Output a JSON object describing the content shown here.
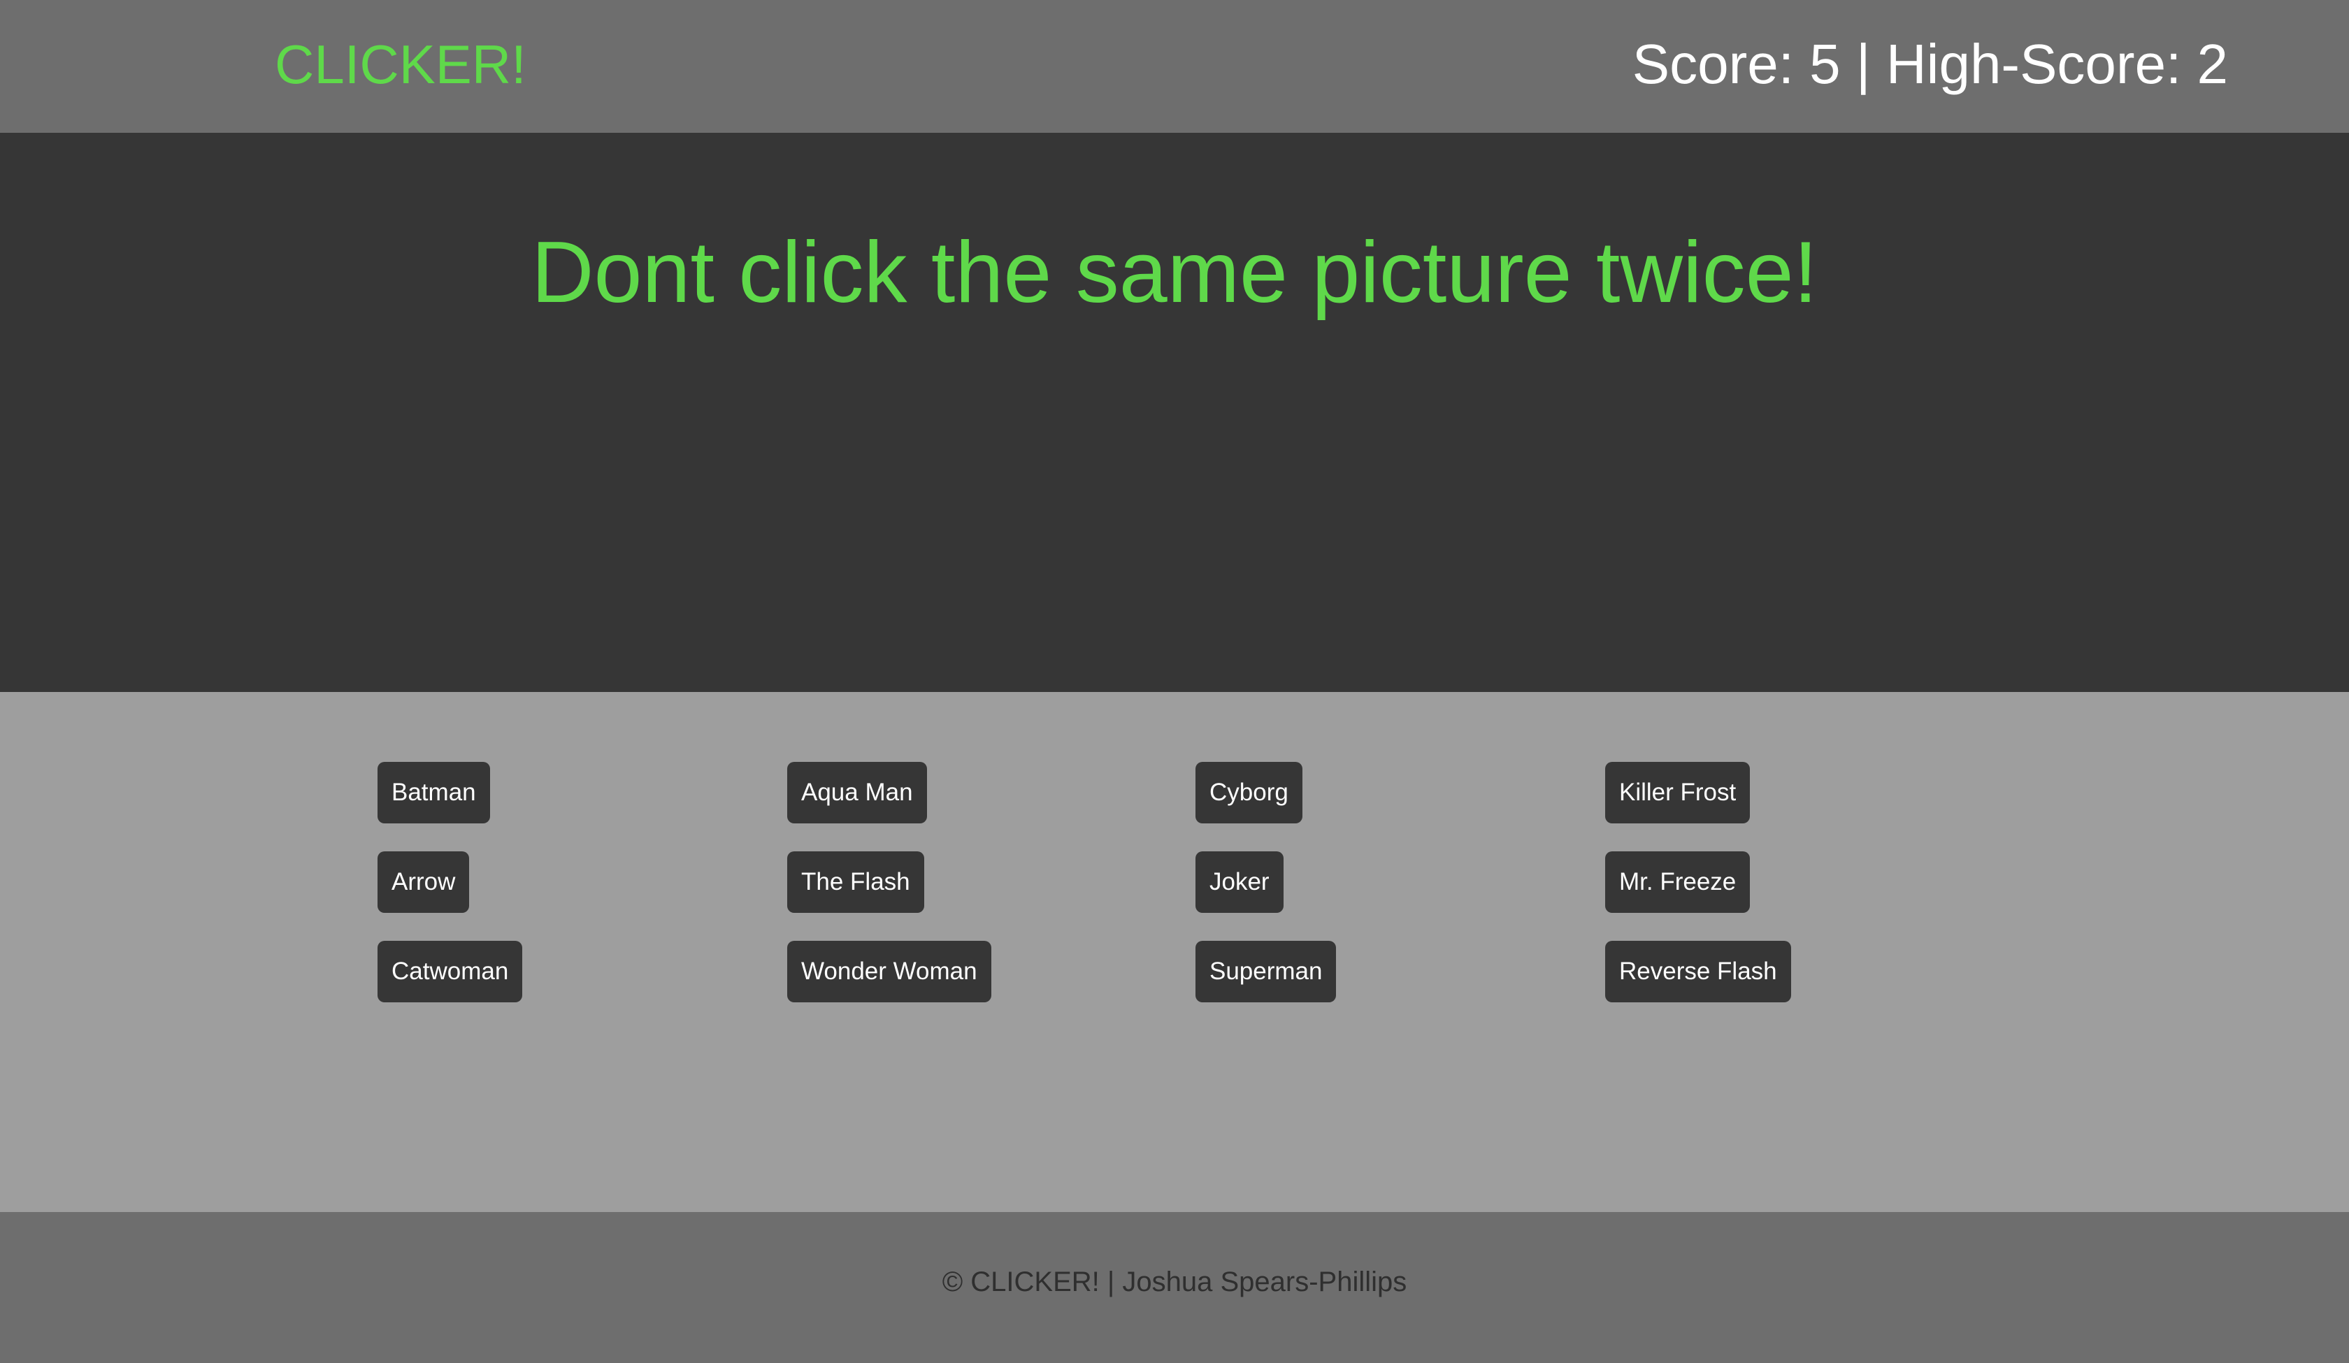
{
  "header": {
    "brand": "CLICKER!",
    "score_text": "Score: 5 | High-Score: 2"
  },
  "hero": {
    "title": "Dont click the same picture twice!"
  },
  "cards": [
    "Batman",
    "Aqua Man",
    "Cyborg",
    "Killer Frost",
    "Arrow",
    "The Flash",
    "Joker",
    "Mr. Freeze",
    "Catwoman",
    "Wonder Woman",
    "Superman",
    "Reverse Flash"
  ],
  "footer": {
    "text": "© CLICKER! | Joshua Spears-Phillips"
  },
  "colors": {
    "accent": "#5fd94a",
    "header_bg": "#6e6e6e",
    "hero_bg": "#363636",
    "cards_bg": "#9e9e9e",
    "button_bg": "#363636"
  }
}
